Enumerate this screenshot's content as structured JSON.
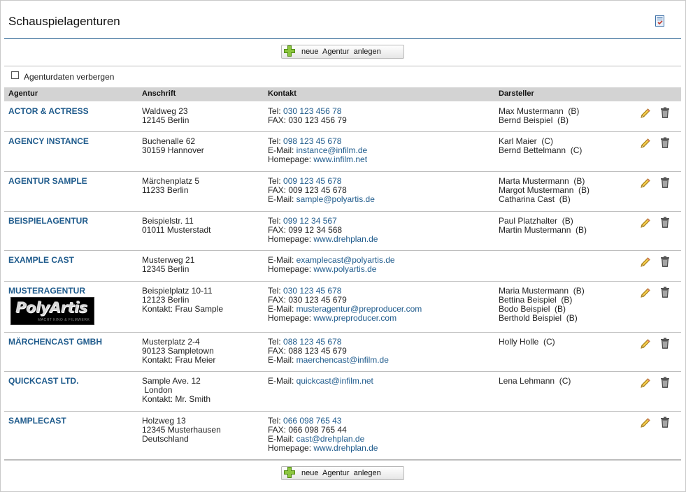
{
  "page": {
    "title": "Schauspielagenturen",
    "title_icon": "print-icon",
    "accent_color": "#1f5b8c"
  },
  "toolbar": {
    "add_label": "neue  Agentur  anlegen",
    "add_icon": "plus-icon"
  },
  "options": {
    "hide_label": "Agenturdaten verbergen",
    "hide_checked": false
  },
  "table": {
    "headers": [
      "Agentur",
      "Anschrift",
      "Kontakt",
      "Darsteller"
    ],
    "rows": [
      {
        "name": "ACTOR & ACTRESS",
        "address": [
          "Waldweg 23",
          "12145 Berlin"
        ],
        "contact": [
          {
            "label": "Tel: ",
            "value": "030 123 456 78",
            "link": true
          },
          {
            "label": "FAX: ",
            "value": "030 123 456 79",
            "link": false
          }
        ],
        "actors": [
          "Max Mustermann  (B)",
          "Bernd Beispiel  (B)"
        ]
      },
      {
        "name": "AGENCY INSTANCE",
        "address": [
          "Buchenalle 62",
          "30159 Hannover"
        ],
        "contact": [
          {
            "label": "Tel: ",
            "value": "098 123 45 678",
            "link": true
          },
          {
            "label": "E-Mail: ",
            "value": "instance@infilm.de",
            "link": true
          },
          {
            "label": "Homepage: ",
            "value": "www.infilm.net",
            "link": true
          }
        ],
        "actors": [
          "Karl Maier  (C)",
          "Bernd Bettelmann  (C)"
        ]
      },
      {
        "name": "AGENTUR SAMPLE",
        "address": [
          "Märchenplatz 5",
          "11233 Berlin"
        ],
        "contact": [
          {
            "label": "Tel: ",
            "value": "009 123 45 678",
            "link": true
          },
          {
            "label": "FAX: ",
            "value": "009 123 45 678",
            "link": false
          },
          {
            "label": "E-Mail: ",
            "value": "sample@polyartis.de",
            "link": true
          }
        ],
        "actors": [
          "Marta Mustermann  (B)",
          "Margot Mustermann  (B)",
          "Catharina Cast  (B)"
        ]
      },
      {
        "name": "BEISPIELAGENTUR",
        "address": [
          "Beispielstr. 11",
          "01011 Musterstadt"
        ],
        "contact": [
          {
            "label": "Tel: ",
            "value": "099 12 34 567",
            "link": true
          },
          {
            "label": "FAX: ",
            "value": "099 12 34 568",
            "link": false
          },
          {
            "label": "Homepage: ",
            "value": "www.drehplan.de",
            "link": true
          }
        ],
        "actors": [
          "Paul Platzhalter  (B)",
          "Martin Mustermann  (B)"
        ]
      },
      {
        "name": "EXAMPLE CAST",
        "address": [
          "Musterweg 21",
          "12345 Berlin"
        ],
        "contact": [
          {
            "label": "E-Mail: ",
            "value": "examplecast@polyartis.de",
            "link": true
          },
          {
            "label": "Homepage: ",
            "value": "www.polyartis.de",
            "link": true
          }
        ],
        "actors": []
      },
      {
        "name": "MUSTERAGENTUR",
        "logo_text": "PolyArtis",
        "logo_subtext": "MACHT KINO & FILMWERK",
        "address": [
          "Beispielplatz 10-11",
          "12123 Berlin",
          "Kontakt: Frau Sample"
        ],
        "contact": [
          {
            "label": "Tel: ",
            "value": "030 123 45 678",
            "link": true
          },
          {
            "label": "FAX: ",
            "value": "030 123 45 679",
            "link": false
          },
          {
            "label": "E-Mail: ",
            "value": "musteragentur@preproducer.com",
            "link": true
          },
          {
            "label": "Homepage: ",
            "value": "www.preproducer.com",
            "link": true
          }
        ],
        "actors": [
          "Maria Mustermann  (B)",
          "Bettina Beispiel  (B)",
          "Bodo Beispiel  (B)",
          "Berthold Beispiel  (B)"
        ]
      },
      {
        "name": "MÄRCHENCAST GMBH",
        "address": [
          "Musterplatz 2-4",
          "90123 Sampletown",
          "Kontakt: Frau Meier"
        ],
        "contact": [
          {
            "label": "Tel: ",
            "value": "088 123 45 678",
            "link": true
          },
          {
            "label": "FAX: ",
            "value": "088 123 45 679",
            "link": false
          },
          {
            "label": "E-Mail: ",
            "value": "maerchencast@infilm.de",
            "link": true
          }
        ],
        "actors": [
          "Holly Holle  (C)"
        ]
      },
      {
        "name": "QUICKCAST LTD.",
        "address": [
          "Sample Ave. 12",
          " London",
          "Kontakt: Mr. Smith"
        ],
        "contact": [
          {
            "label": "E-Mail: ",
            "value": "quickcast@infilm.net",
            "link": true
          }
        ],
        "actors": [
          "Lena Lehmann  (C)"
        ]
      },
      {
        "name": "SAMPLECAST",
        "address": [
          "Holzweg 13",
          "12345 Musterhausen",
          "Deutschland"
        ],
        "contact": [
          {
            "label": "Tel: ",
            "value": "066 098 765 43",
            "link": true
          },
          {
            "label": "FAX: ",
            "value": "066 098 765 44",
            "link": false
          },
          {
            "label": "E-Mail: ",
            "value": "cast@drehplan.de",
            "link": true
          },
          {
            "label": "Homepage: ",
            "value": "www.drehplan.de",
            "link": true
          }
        ],
        "actors": []
      }
    ]
  }
}
